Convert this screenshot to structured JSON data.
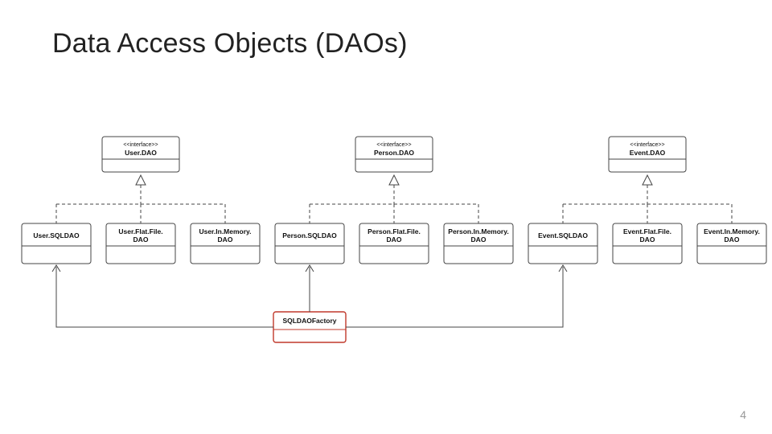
{
  "title": "Data Access Objects (DAOs)",
  "pageNumber": "4",
  "interfaces": [
    {
      "stereotype": "<<interface>>",
      "name": "User.DAO"
    },
    {
      "stereotype": "<<interface>>",
      "name": "Person.DAO"
    },
    {
      "stereotype": "<<interface>>",
      "name": "Event.DAO"
    }
  ],
  "classes": [
    {
      "line1": "User.SQLDAO",
      "line2": ""
    },
    {
      "line1": "User.Flat.File.",
      "line2": "DAO"
    },
    {
      "line1": "User.In.Memory.",
      "line2": "DAO"
    },
    {
      "line1": "Person.SQLDAO",
      "line2": ""
    },
    {
      "line1": "Person.Flat.File.",
      "line2": "DAO"
    },
    {
      "line1": "Person.In.Memory.",
      "line2": "DAO"
    },
    {
      "line1": "Event.SQLDAO",
      "line2": ""
    },
    {
      "line1": "Event.Flat.File.",
      "line2": "DAO"
    },
    {
      "line1": "Event.In.Memory.",
      "line2": "DAO"
    }
  ],
  "factory": {
    "name": "SQLDAOFactory"
  }
}
